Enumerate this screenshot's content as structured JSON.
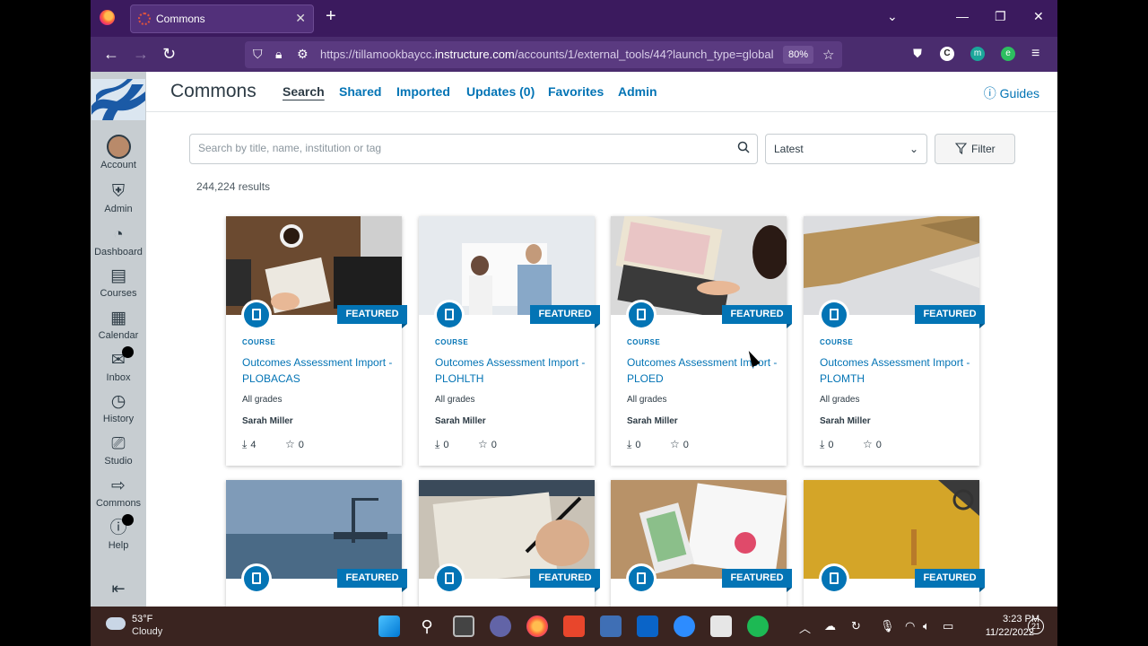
{
  "browser": {
    "tab_title": "Commons",
    "url_prefix": "https://tillamookbaycc.",
    "url_domain": "instructure.com",
    "url_suffix": "/accounts/1/external_tools/44?launch_type=global",
    "zoom": "80%"
  },
  "sidebar": {
    "items": [
      {
        "label": "Account",
        "icon": "account-avatar"
      },
      {
        "label": "Admin",
        "icon": "shield-icon"
      },
      {
        "label": "Dashboard",
        "icon": "speedometer-icon"
      },
      {
        "label": "Courses",
        "icon": "book-icon"
      },
      {
        "label": "Calendar",
        "icon": "calendar-icon"
      },
      {
        "label": "Inbox",
        "icon": "inbox-icon"
      },
      {
        "label": "History",
        "icon": "clock-icon"
      },
      {
        "label": "Studio",
        "icon": "studio-icon"
      },
      {
        "label": "Commons",
        "icon": "commons-icon"
      },
      {
        "label": "Help",
        "icon": "help-icon"
      }
    ],
    "collapse_label": "⇤"
  },
  "app": {
    "title": "Commons",
    "nav": [
      "Search",
      "Shared",
      "Imported",
      "Updates (0)",
      "Favorites",
      "Admin"
    ],
    "guides": "Guides",
    "search_placeholder": "Search by title, name, institution or tag",
    "sort_value": "Latest",
    "filter_label": "Filter",
    "results": "244,224 results"
  },
  "cards": [
    {
      "type": "COURSE",
      "title": "Outcomes Assessment Import - PLOBACAS",
      "grades": "All grades",
      "author": "Sarah Miller",
      "downloads": "4",
      "favorites": "0",
      "badge": "FEATURED"
    },
    {
      "type": "COURSE",
      "title": "Outcomes Assessment Import - PLOHLTH",
      "grades": "All grades",
      "author": "Sarah Miller",
      "downloads": "0",
      "favorites": "0",
      "badge": "FEATURED"
    },
    {
      "type": "COURSE",
      "title": "Outcomes Assessment Import - PLOED",
      "grades": "All grades",
      "author": "Sarah Miller",
      "downloads": "0",
      "favorites": "0",
      "badge": "FEATURED"
    },
    {
      "type": "COURSE",
      "title": "Outcomes Assessment Import - PLOMTH",
      "grades": "All grades",
      "author": "Sarah Miller",
      "downloads": "0",
      "favorites": "0",
      "badge": "FEATURED"
    },
    {
      "badge": "FEATURED"
    },
    {
      "badge": "FEATURED"
    },
    {
      "badge": "FEATURED"
    },
    {
      "badge": "FEATURED"
    }
  ],
  "taskbar": {
    "temp": "53°F",
    "weather": "Cloudy",
    "time": "3:23 PM",
    "date": "11/22/2022",
    "notifications": "21"
  },
  "colors": {
    "canvas_blue": "#0374b5",
    "browser_purple": "#4a2c6e",
    "sidebar_gray": "#c7cdd1"
  }
}
